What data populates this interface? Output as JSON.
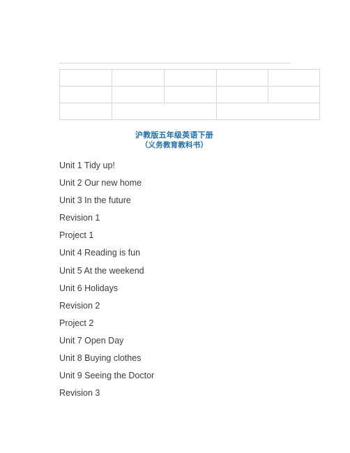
{
  "document": {
    "background_color": "#ffffff",
    "rule_color": "#d4d4d4",
    "table_border_color": "#d8d8d8",
    "title_color": "#1F6FAE",
    "body_text_color": "#3c3c3c"
  },
  "table": {
    "rows": [
      {
        "cells": [
          {
            "text": ""
          },
          {
            "text": ""
          },
          {
            "text": ""
          },
          {
            "text": ""
          },
          {
            "text": ""
          }
        ]
      },
      {
        "cells": [
          {
            "text": ""
          },
          {
            "text": ""
          },
          {
            "text": ""
          },
          {
            "text": ""
          },
          {
            "text": ""
          }
        ]
      },
      {
        "cells": [
          {
            "text": ""
          },
          {
            "text": ""
          },
          {
            "text": ""
          }
        ]
      }
    ]
  },
  "title": {
    "line_1": "沪教版五年级英语下册",
    "line_2": "（义务教育教科书）"
  },
  "contents": {
    "items": [
      {
        "label": "Unit 1 Tidy up!"
      },
      {
        "label": "Unit 2 Our new home"
      },
      {
        "label": "Unit 3 In the future"
      },
      {
        "label": "Revision 1"
      },
      {
        "label": "Project 1"
      },
      {
        "label": "Unit 4 Reading is fun"
      },
      {
        "label": "Unit 5 At the weekend"
      },
      {
        "label": "Unit 6 Holidays"
      },
      {
        "label": "Revision 2"
      },
      {
        "label": "Project 2"
      },
      {
        "label": "Unit 7 Open Day"
      },
      {
        "label": "Unit 8 Buying clothes"
      },
      {
        "label": "Unit 9 Seeing the Doctor"
      },
      {
        "label": "Revision 3"
      }
    ]
  }
}
